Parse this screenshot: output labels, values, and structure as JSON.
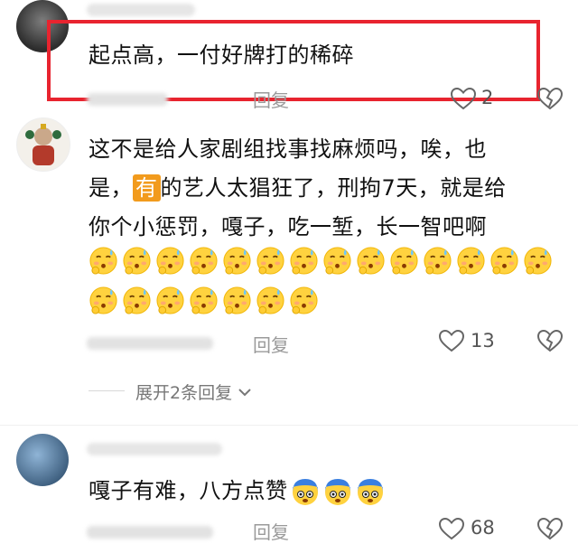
{
  "comments": [
    {
      "text": "起点高，一付好牌打的稀碎",
      "reply_label": "回复",
      "likes": "2"
    },
    {
      "text_parts": [
        "这不是给人家剧组找事找麻烦吗，唉，也",
        "是，",
        "有",
        "的艺人太猖狂了，刑拘7天，就是给",
        "你个小惩罚，嘎子，吃一堑，长一智吧啊"
      ],
      "reply_label": "回复",
      "likes": "13",
      "expand_label": "展开2条回复",
      "emoji_icon": "sweating-thinking-face-emoji",
      "emoji_count_row1": 14,
      "emoji_count_row2": 7
    },
    {
      "text": "嘎子有难，八方点赞",
      "reply_label": "回复",
      "likes": "68",
      "emoji_icon": "shocked-blue-face-emoji",
      "emoji_count": 3
    }
  ],
  "colors": {
    "highlight_box": "#e8242f",
    "keyword_badge": "#f29b1d",
    "meta_gray": "#9a9a9a"
  },
  "icons": [
    "heart-outline-icon",
    "broken-heart-icon",
    "chevron-down-icon"
  ]
}
